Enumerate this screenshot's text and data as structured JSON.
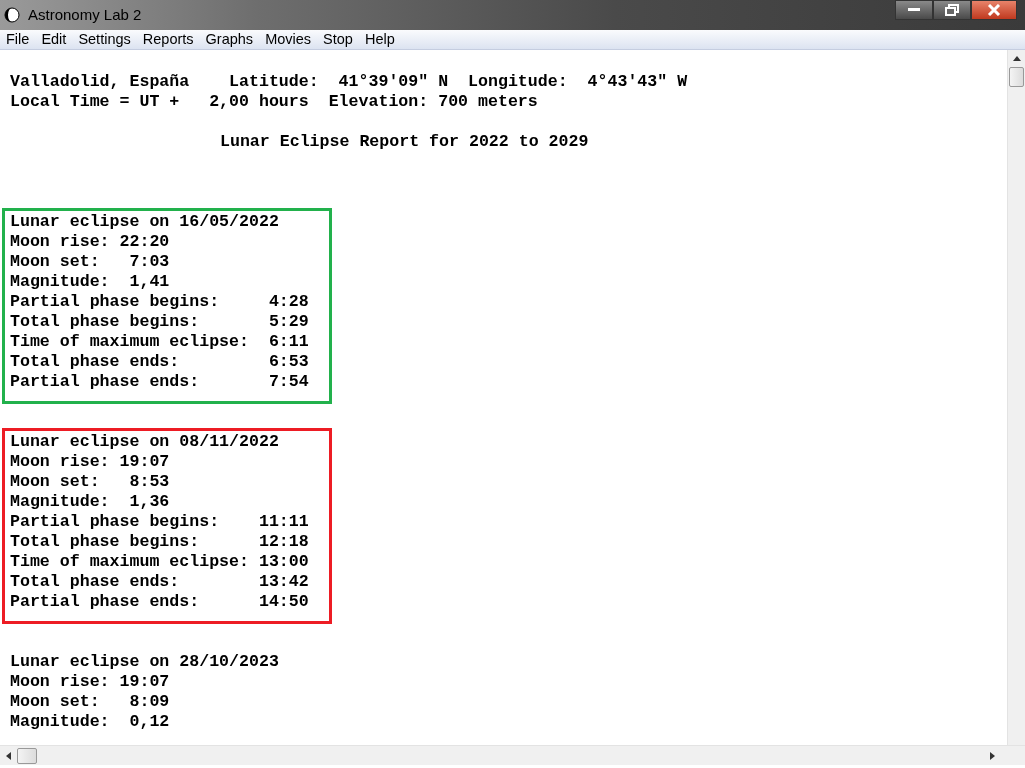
{
  "window": {
    "title": "Astronomy Lab 2"
  },
  "menu": [
    "File",
    "Edit",
    "Settings",
    "Reports",
    "Graphs",
    "Movies",
    "Stop",
    "Help"
  ],
  "report": {
    "header_lines": [
      "Valladolid, España    Latitude:  41°39'09\" N  Longitude:  4°43'43\" W",
      "Local Time = UT +   2,00 hours  Elevation: 700 meters"
    ],
    "title": "Lunar Eclipse Report for 2022 to 2029",
    "eclipses": [
      {
        "color": "#22b14c",
        "lines": [
          "Lunar eclipse on 16/05/2022",
          "Moon rise: 22:20",
          "Moon set:   7:03",
          "Magnitude:  1,41",
          "Partial phase begins:     4:28",
          "Total phase begins:       5:29",
          "Time of maximum eclipse:  6:11",
          "Total phase ends:         6:53",
          "Partial phase ends:       7:54"
        ]
      },
      {
        "color": "#ed1c24",
        "lines": [
          "Lunar eclipse on 08/11/2022",
          "Moon rise: 19:07",
          "Moon set:   8:53",
          "Magnitude:  1,36",
          "Partial phase begins:    11:11",
          "Total phase begins:      12:18",
          "Time of maximum eclipse: 13:00",
          "Total phase ends:        13:42",
          "Partial phase ends:      14:50"
        ]
      },
      {
        "lines": [
          "Lunar eclipse on 28/10/2023",
          "Moon rise: 19:07",
          "Moon set:   8:09",
          "Magnitude:  0,12"
        ]
      }
    ]
  }
}
